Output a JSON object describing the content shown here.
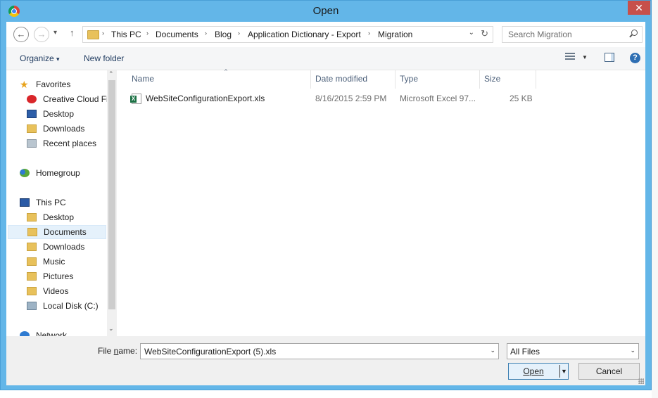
{
  "window": {
    "title": "Open",
    "close_glyph": "✕",
    "app_icon": "chrome-icon"
  },
  "navigation": {
    "back": "←",
    "forward": "→",
    "up": "↑",
    "recent_dropdown": "▾"
  },
  "address": {
    "breadcrumbs": [
      "This PC",
      "Documents",
      "Blog",
      "Application Dictionary - Export",
      "Migration"
    ],
    "separator": "›",
    "dropdown": "⌄",
    "refresh": "↻"
  },
  "search": {
    "placeholder": "Search Migration",
    "value": ""
  },
  "toolbar": {
    "organize": "Organize",
    "organize_arrow": "▾",
    "new_folder": "New folder",
    "views_arrow": "▼",
    "help": "?"
  },
  "sidebar": {
    "items": [
      {
        "label": "Favorites",
        "icon": "star-icon"
      },
      {
        "label": "Creative Cloud Fi",
        "icon": "creative-cloud-icon"
      },
      {
        "label": "Desktop",
        "icon": "desktop-icon"
      },
      {
        "label": "Downloads",
        "icon": "downloads-folder-icon"
      },
      {
        "label": "Recent places",
        "icon": "recent-places-icon"
      },
      {
        "label": "Homegroup",
        "icon": "homegroup-icon"
      },
      {
        "label": "This PC",
        "icon": "computer-icon"
      },
      {
        "label": "Desktop",
        "icon": "desktop-folder-icon"
      },
      {
        "label": "Documents",
        "icon": "documents-folder-icon",
        "selected": true
      },
      {
        "label": "Downloads",
        "icon": "downloads-folder-icon"
      },
      {
        "label": "Music",
        "icon": "music-folder-icon"
      },
      {
        "label": "Pictures",
        "icon": "pictures-folder-icon"
      },
      {
        "label": "Videos",
        "icon": "videos-folder-icon"
      },
      {
        "label": "Local Disk (C:)",
        "icon": "disk-icon"
      },
      {
        "label": "Network",
        "icon": "network-icon"
      }
    ],
    "scroll_up": "⌃",
    "scroll_down": "⌄"
  },
  "columns": {
    "name": "Name",
    "date": "Date modified",
    "type": "Type",
    "size": "Size",
    "sort_indicator": "^"
  },
  "files": [
    {
      "name": "WebSiteConfigurationExport.xls",
      "date": "8/16/2015 2:59 PM",
      "type": "Microsoft Excel 97...",
      "size": "25 KB",
      "icon": "excel-file-icon"
    }
  ],
  "bottom": {
    "file_name_label_prefix": "File ",
    "file_name_label_accel": "n",
    "file_name_label_suffix": "ame:",
    "file_name_value": "WebSiteConfigurationExport (5).xls",
    "filter_value": "All Files",
    "open_label": "Open",
    "cancel_label": "Cancel",
    "dropdown_arrow": "⌄"
  },
  "colors": {
    "window_frame": "#63b6e8",
    "close_button": "#c7504b",
    "selection": "#e5f1fb"
  }
}
